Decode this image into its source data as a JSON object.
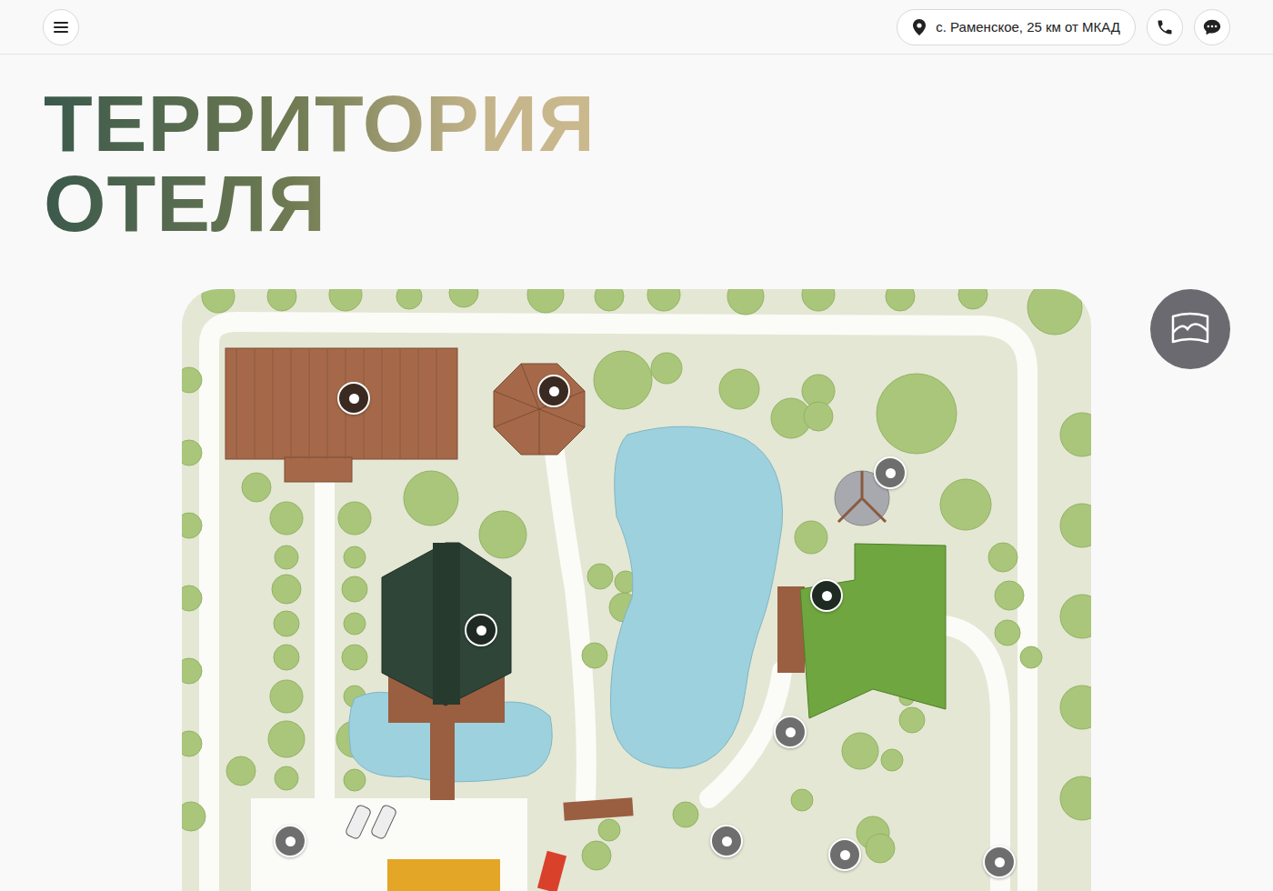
{
  "header": {
    "address": "с. Раменское, 25 км от МКАД"
  },
  "title": [
    "ТЕРРИТОРИЯ",
    "ОТЕЛЯ"
  ],
  "map": {
    "pins": [
      {
        "color": "#3b2a22"
      },
      {
        "color": "#3b2a22"
      },
      {
        "color": "#1f2a22"
      },
      {
        "color": "#6e6e6e"
      },
      {
        "color": "#1f2a22"
      },
      {
        "color": "#6e6e6e"
      },
      {
        "color": "#6e6e6e"
      },
      {
        "color": "#6e6e6e"
      },
      {
        "color": "#6e6e6e"
      },
      {
        "color": "#6e6e6e"
      }
    ]
  }
}
